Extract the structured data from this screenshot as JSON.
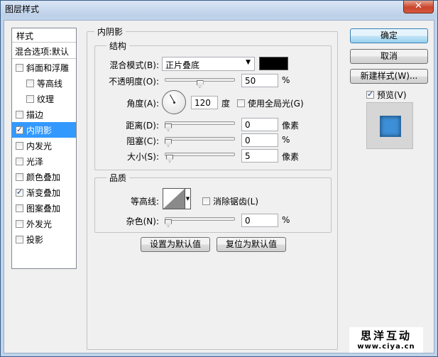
{
  "window": {
    "title": "图层样式",
    "close_label": "✕"
  },
  "styles_panel": {
    "header": "样式",
    "blend_options": "混合选项:默认",
    "items": [
      {
        "label": "斜面和浮雕",
        "checked": false,
        "selected": false,
        "indent": false
      },
      {
        "label": "等高线",
        "checked": false,
        "selected": false,
        "indent": true
      },
      {
        "label": "纹理",
        "checked": false,
        "selected": false,
        "indent": true
      },
      {
        "label": "描边",
        "checked": false,
        "selected": false,
        "indent": false
      },
      {
        "label": "内阴影",
        "checked": true,
        "selected": true,
        "indent": false
      },
      {
        "label": "内发光",
        "checked": false,
        "selected": false,
        "indent": false
      },
      {
        "label": "光泽",
        "checked": false,
        "selected": false,
        "indent": false
      },
      {
        "label": "颜色叠加",
        "checked": false,
        "selected": false,
        "indent": false
      },
      {
        "label": "渐变叠加",
        "checked": true,
        "selected": false,
        "indent": false
      },
      {
        "label": "图案叠加",
        "checked": false,
        "selected": false,
        "indent": false
      },
      {
        "label": "外发光",
        "checked": false,
        "selected": false,
        "indent": false
      },
      {
        "label": "投影",
        "checked": false,
        "selected": false,
        "indent": false
      }
    ]
  },
  "inner_shadow": {
    "title": "内阴影",
    "structure": {
      "title": "结构",
      "blend_mode_label": "混合模式(B):",
      "blend_mode_value": "正片叠底",
      "shadow_color": "#000000",
      "opacity_label": "不透明度(O):",
      "opacity_value": "50",
      "opacity_unit": "%",
      "opacity_fraction": 0.5,
      "angle_label": "角度(A):",
      "angle_value": "120",
      "angle_unit": "度",
      "global_light_label": "使用全局光(G)",
      "global_light_checked": false,
      "distance_label": "距离(D):",
      "distance_value": "0",
      "distance_unit": "像素",
      "choke_label": "阻塞(C):",
      "choke_value": "0",
      "choke_unit": "%",
      "size_label": "大小(S):",
      "size_value": "5",
      "size_unit": "像素"
    },
    "quality": {
      "title": "品质",
      "contour_label": "等高线:",
      "anti_alias_label": "消除锯齿(L)",
      "anti_alias_checked": false,
      "noise_label": "杂色(N):",
      "noise_value": "0",
      "noise_unit": "%"
    },
    "make_default_label": "设置为默认值",
    "reset_default_label": "复位为默认值"
  },
  "actions": {
    "ok_label": "确定",
    "cancel_label": "取消",
    "new_style_label": "新建样式(W)...",
    "preview_label": "预览(V)",
    "preview_checked": true
  },
  "watermark": {
    "title": "思洋互动",
    "url": "www.ciya.cn"
  },
  "colors": {
    "selection": "#3399ff",
    "preview_fill": "#3d8fd8"
  }
}
